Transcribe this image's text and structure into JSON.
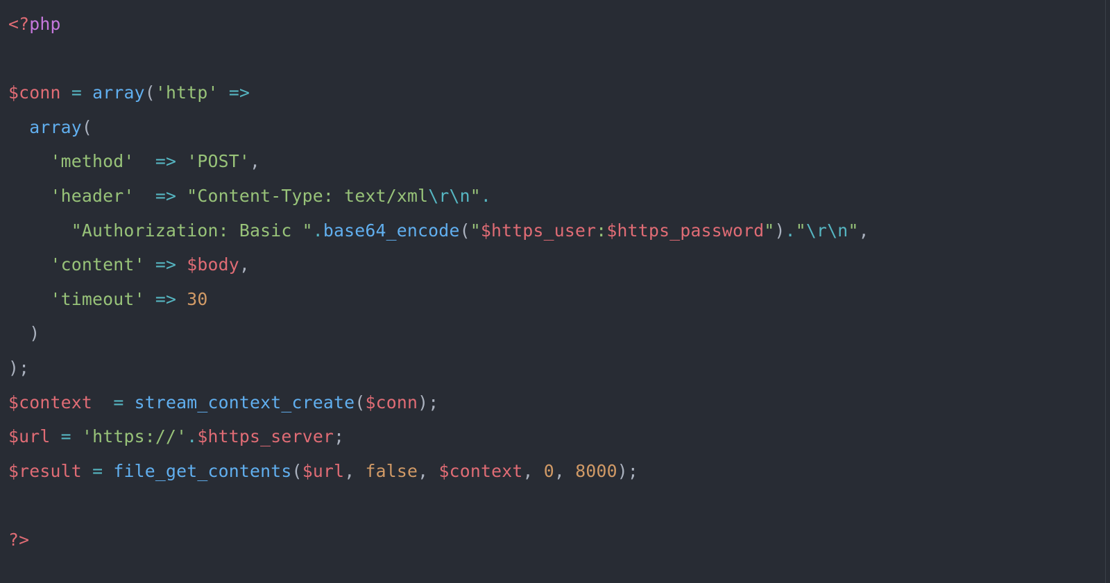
{
  "code": {
    "open_bracket": "<?",
    "php_kw": "php",
    "close_bracket": "?>",
    "dollar": "$",
    "vars": {
      "conn": "conn",
      "body": "body",
      "context": "context",
      "url": "url",
      "https_server": "https_server",
      "result": "result"
    },
    "funcs": {
      "array": "array",
      "base64_encode": "base64_encode",
      "stream_context_create": "stream_context_create",
      "file_get_contents": "file_get_contents"
    },
    "strings": {
      "http": "'http'",
      "method": "'method'",
      "post": "'POST'",
      "header": "'header'",
      "ct_open": "\"Content-Type: text/xml",
      "rn": "\\r\\n",
      "ct_close": "\"",
      "auth_open": "\"Authorization: Basic \"",
      "cred_open": "\"",
      "https_user": "$https_user",
      "colon": ":",
      "https_password": "$https_password",
      "cred_close": "\"",
      "rn2_open": "\"",
      "rn2_close": "\"",
      "content": "'content'",
      "timeout": "'timeout'",
      "https_scheme": "'https://'"
    },
    "nums": {
      "n30": "30",
      "n0": "0",
      "n8000": "8000"
    },
    "consts": {
      "false_kw": "false"
    },
    "ops": {
      "eq": "=",
      "arrow": "=>",
      "dot": "."
    },
    "punc": {
      "lparen": "(",
      "rparen": ")",
      "comma": ",",
      "semi": ";"
    }
  }
}
